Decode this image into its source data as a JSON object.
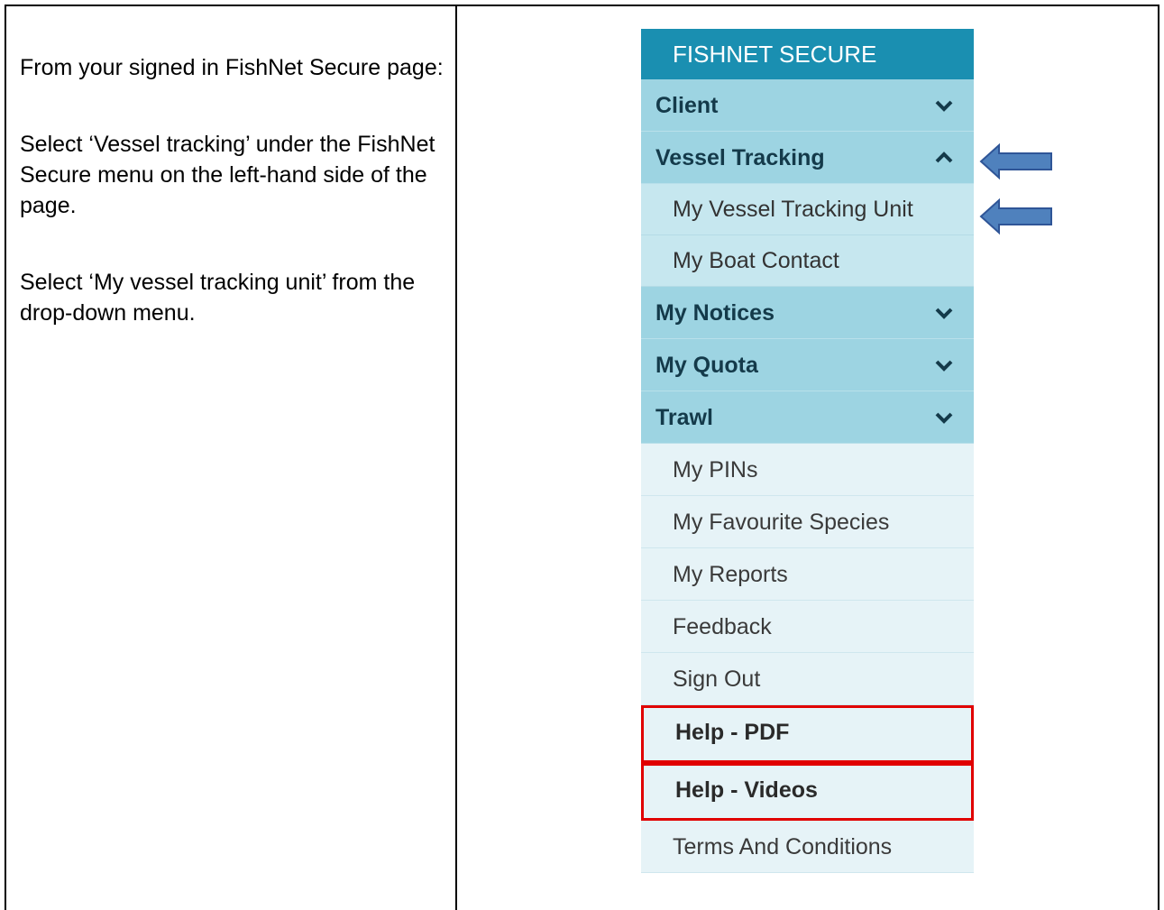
{
  "instructions": {
    "p1": "From your signed in FishNet Secure page:",
    "p2": "Select ‘Vessel tracking’ under the FishNet Secure menu on the left-hand side of the page.",
    "p3": "Select ‘My vessel tracking unit’ from the drop-down menu."
  },
  "menu": {
    "header": "FISHNET SECURE",
    "items": [
      {
        "label": "Client",
        "type": "category",
        "icon": "chevron-down-icon"
      },
      {
        "label": "Vessel Tracking",
        "type": "category",
        "icon": "chevron-up-icon"
      },
      {
        "label": "My Vessel Tracking Unit",
        "type": "subitem"
      },
      {
        "label": "My Boat Contact",
        "type": "subitem"
      },
      {
        "label": "My Notices",
        "type": "category",
        "icon": "chevron-down-icon"
      },
      {
        "label": "My Quota",
        "type": "category",
        "icon": "chevron-down-icon"
      },
      {
        "label": "Trawl",
        "type": "category",
        "icon": "chevron-down-icon"
      },
      {
        "label": "My PINs",
        "type": "link"
      },
      {
        "label": "My Favourite Species",
        "type": "link"
      },
      {
        "label": "My Reports",
        "type": "link"
      },
      {
        "label": "Feedback",
        "type": "link"
      },
      {
        "label": "Sign Out",
        "type": "link"
      },
      {
        "label": "Help - PDF",
        "type": "highlighted"
      },
      {
        "label": "Help - Videos",
        "type": "highlighted"
      },
      {
        "label": "Terms And Conditions",
        "type": "link"
      }
    ]
  },
  "colors": {
    "header": "#1a8fb1",
    "category": "#9dd4e2",
    "subitem": "#c6e7ef",
    "link": "#e6f3f7",
    "highlight_border": "#e00000",
    "arrow": "#4f81bd"
  }
}
